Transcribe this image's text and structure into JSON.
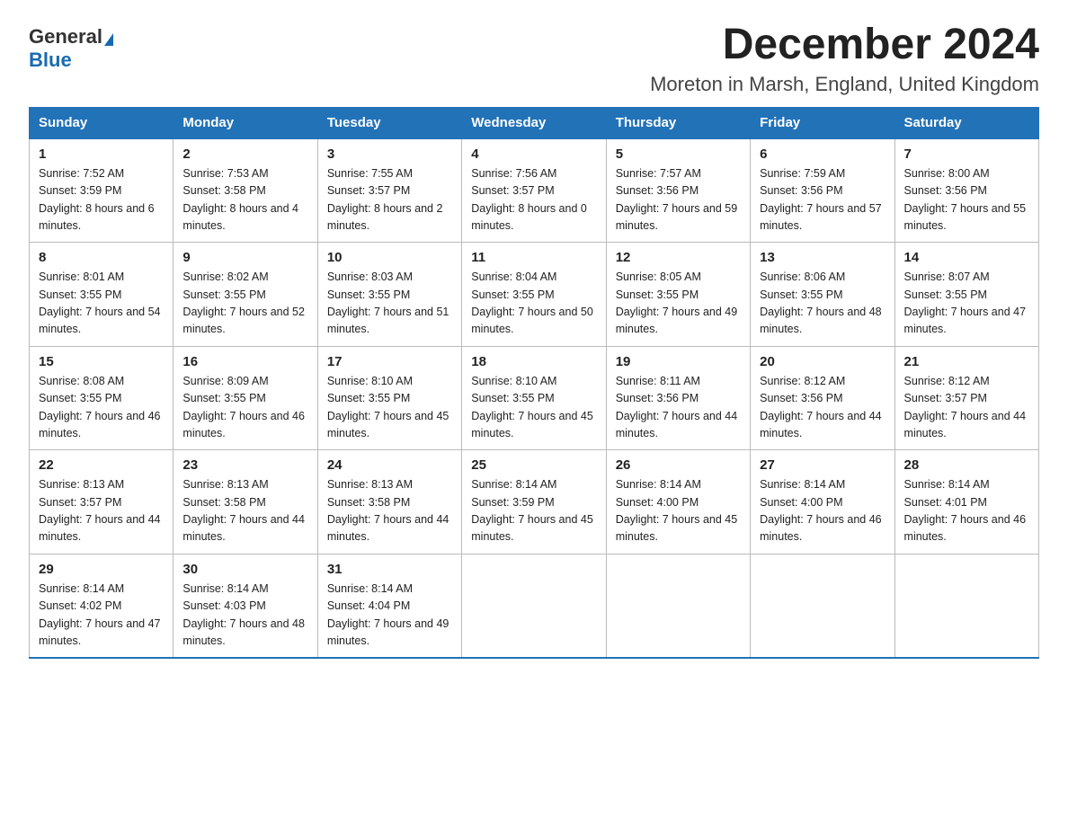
{
  "logo": {
    "general": "General",
    "blue": "Blue"
  },
  "title": "December 2024",
  "subtitle": "Moreton in Marsh, England, United Kingdom",
  "days_of_week": [
    "Sunday",
    "Monday",
    "Tuesday",
    "Wednesday",
    "Thursday",
    "Friday",
    "Saturday"
  ],
  "weeks": [
    [
      {
        "day": "1",
        "sunrise": "7:52 AM",
        "sunset": "3:59 PM",
        "daylight": "8 hours and 6 minutes."
      },
      {
        "day": "2",
        "sunrise": "7:53 AM",
        "sunset": "3:58 PM",
        "daylight": "8 hours and 4 minutes."
      },
      {
        "day": "3",
        "sunrise": "7:55 AM",
        "sunset": "3:57 PM",
        "daylight": "8 hours and 2 minutes."
      },
      {
        "day": "4",
        "sunrise": "7:56 AM",
        "sunset": "3:57 PM",
        "daylight": "8 hours and 0 minutes."
      },
      {
        "day": "5",
        "sunrise": "7:57 AM",
        "sunset": "3:56 PM",
        "daylight": "7 hours and 59 minutes."
      },
      {
        "day": "6",
        "sunrise": "7:59 AM",
        "sunset": "3:56 PM",
        "daylight": "7 hours and 57 minutes."
      },
      {
        "day": "7",
        "sunrise": "8:00 AM",
        "sunset": "3:56 PM",
        "daylight": "7 hours and 55 minutes."
      }
    ],
    [
      {
        "day": "8",
        "sunrise": "8:01 AM",
        "sunset": "3:55 PM",
        "daylight": "7 hours and 54 minutes."
      },
      {
        "day": "9",
        "sunrise": "8:02 AM",
        "sunset": "3:55 PM",
        "daylight": "7 hours and 52 minutes."
      },
      {
        "day": "10",
        "sunrise": "8:03 AM",
        "sunset": "3:55 PM",
        "daylight": "7 hours and 51 minutes."
      },
      {
        "day": "11",
        "sunrise": "8:04 AM",
        "sunset": "3:55 PM",
        "daylight": "7 hours and 50 minutes."
      },
      {
        "day": "12",
        "sunrise": "8:05 AM",
        "sunset": "3:55 PM",
        "daylight": "7 hours and 49 minutes."
      },
      {
        "day": "13",
        "sunrise": "8:06 AM",
        "sunset": "3:55 PM",
        "daylight": "7 hours and 48 minutes."
      },
      {
        "day": "14",
        "sunrise": "8:07 AM",
        "sunset": "3:55 PM",
        "daylight": "7 hours and 47 minutes."
      }
    ],
    [
      {
        "day": "15",
        "sunrise": "8:08 AM",
        "sunset": "3:55 PM",
        "daylight": "7 hours and 46 minutes."
      },
      {
        "day": "16",
        "sunrise": "8:09 AM",
        "sunset": "3:55 PM",
        "daylight": "7 hours and 46 minutes."
      },
      {
        "day": "17",
        "sunrise": "8:10 AM",
        "sunset": "3:55 PM",
        "daylight": "7 hours and 45 minutes."
      },
      {
        "day": "18",
        "sunrise": "8:10 AM",
        "sunset": "3:55 PM",
        "daylight": "7 hours and 45 minutes."
      },
      {
        "day": "19",
        "sunrise": "8:11 AM",
        "sunset": "3:56 PM",
        "daylight": "7 hours and 44 minutes."
      },
      {
        "day": "20",
        "sunrise": "8:12 AM",
        "sunset": "3:56 PM",
        "daylight": "7 hours and 44 minutes."
      },
      {
        "day": "21",
        "sunrise": "8:12 AM",
        "sunset": "3:57 PM",
        "daylight": "7 hours and 44 minutes."
      }
    ],
    [
      {
        "day": "22",
        "sunrise": "8:13 AM",
        "sunset": "3:57 PM",
        "daylight": "7 hours and 44 minutes."
      },
      {
        "day": "23",
        "sunrise": "8:13 AM",
        "sunset": "3:58 PM",
        "daylight": "7 hours and 44 minutes."
      },
      {
        "day": "24",
        "sunrise": "8:13 AM",
        "sunset": "3:58 PM",
        "daylight": "7 hours and 44 minutes."
      },
      {
        "day": "25",
        "sunrise": "8:14 AM",
        "sunset": "3:59 PM",
        "daylight": "7 hours and 45 minutes."
      },
      {
        "day": "26",
        "sunrise": "8:14 AM",
        "sunset": "4:00 PM",
        "daylight": "7 hours and 45 minutes."
      },
      {
        "day": "27",
        "sunrise": "8:14 AM",
        "sunset": "4:00 PM",
        "daylight": "7 hours and 46 minutes."
      },
      {
        "day": "28",
        "sunrise": "8:14 AM",
        "sunset": "4:01 PM",
        "daylight": "7 hours and 46 minutes."
      }
    ],
    [
      {
        "day": "29",
        "sunrise": "8:14 AM",
        "sunset": "4:02 PM",
        "daylight": "7 hours and 47 minutes."
      },
      {
        "day": "30",
        "sunrise": "8:14 AM",
        "sunset": "4:03 PM",
        "daylight": "7 hours and 48 minutes."
      },
      {
        "day": "31",
        "sunrise": "8:14 AM",
        "sunset": "4:04 PM",
        "daylight": "7 hours and 49 minutes."
      },
      null,
      null,
      null,
      null
    ]
  ],
  "labels": {
    "sunrise": "Sunrise: ",
    "sunset": "Sunset: ",
    "daylight": "Daylight: "
  }
}
